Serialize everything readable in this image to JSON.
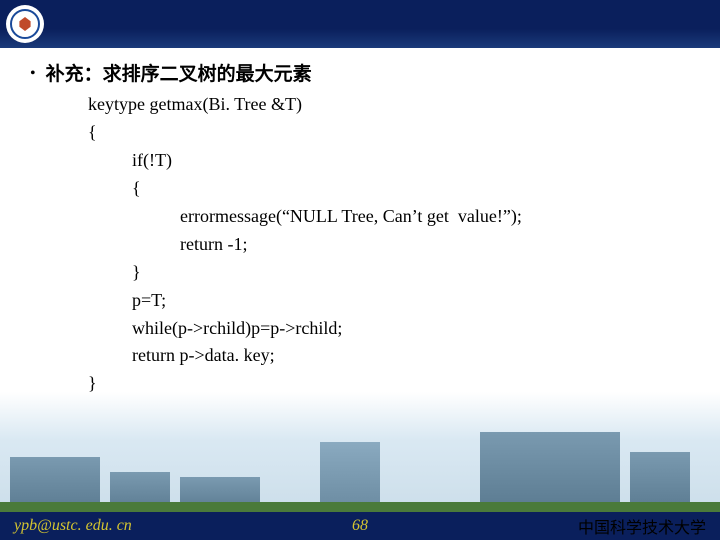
{
  "header": {
    "logo_alt": "ustc-logo"
  },
  "bullet": {
    "dot": "•",
    "title": "补充：求排序二叉树的最大元素"
  },
  "code": {
    "l1": "keytype getmax(Bi. Tree &T)",
    "l2": "{",
    "l3": "if(!T)",
    "l4": "{",
    "l5": "errormessage(“NULL Tree, Can’t get  value!”);",
    "l6": "return -1;",
    "l7": "}",
    "l8": "p=T;",
    "l9": "while(p->rchild)p=p->rchild;",
    "l10": "return p->data. key;",
    "l11": "}"
  },
  "footer": {
    "email": "ypb@ustc. edu. cn",
    "page": "68",
    "org": "中国科学技术大学"
  }
}
